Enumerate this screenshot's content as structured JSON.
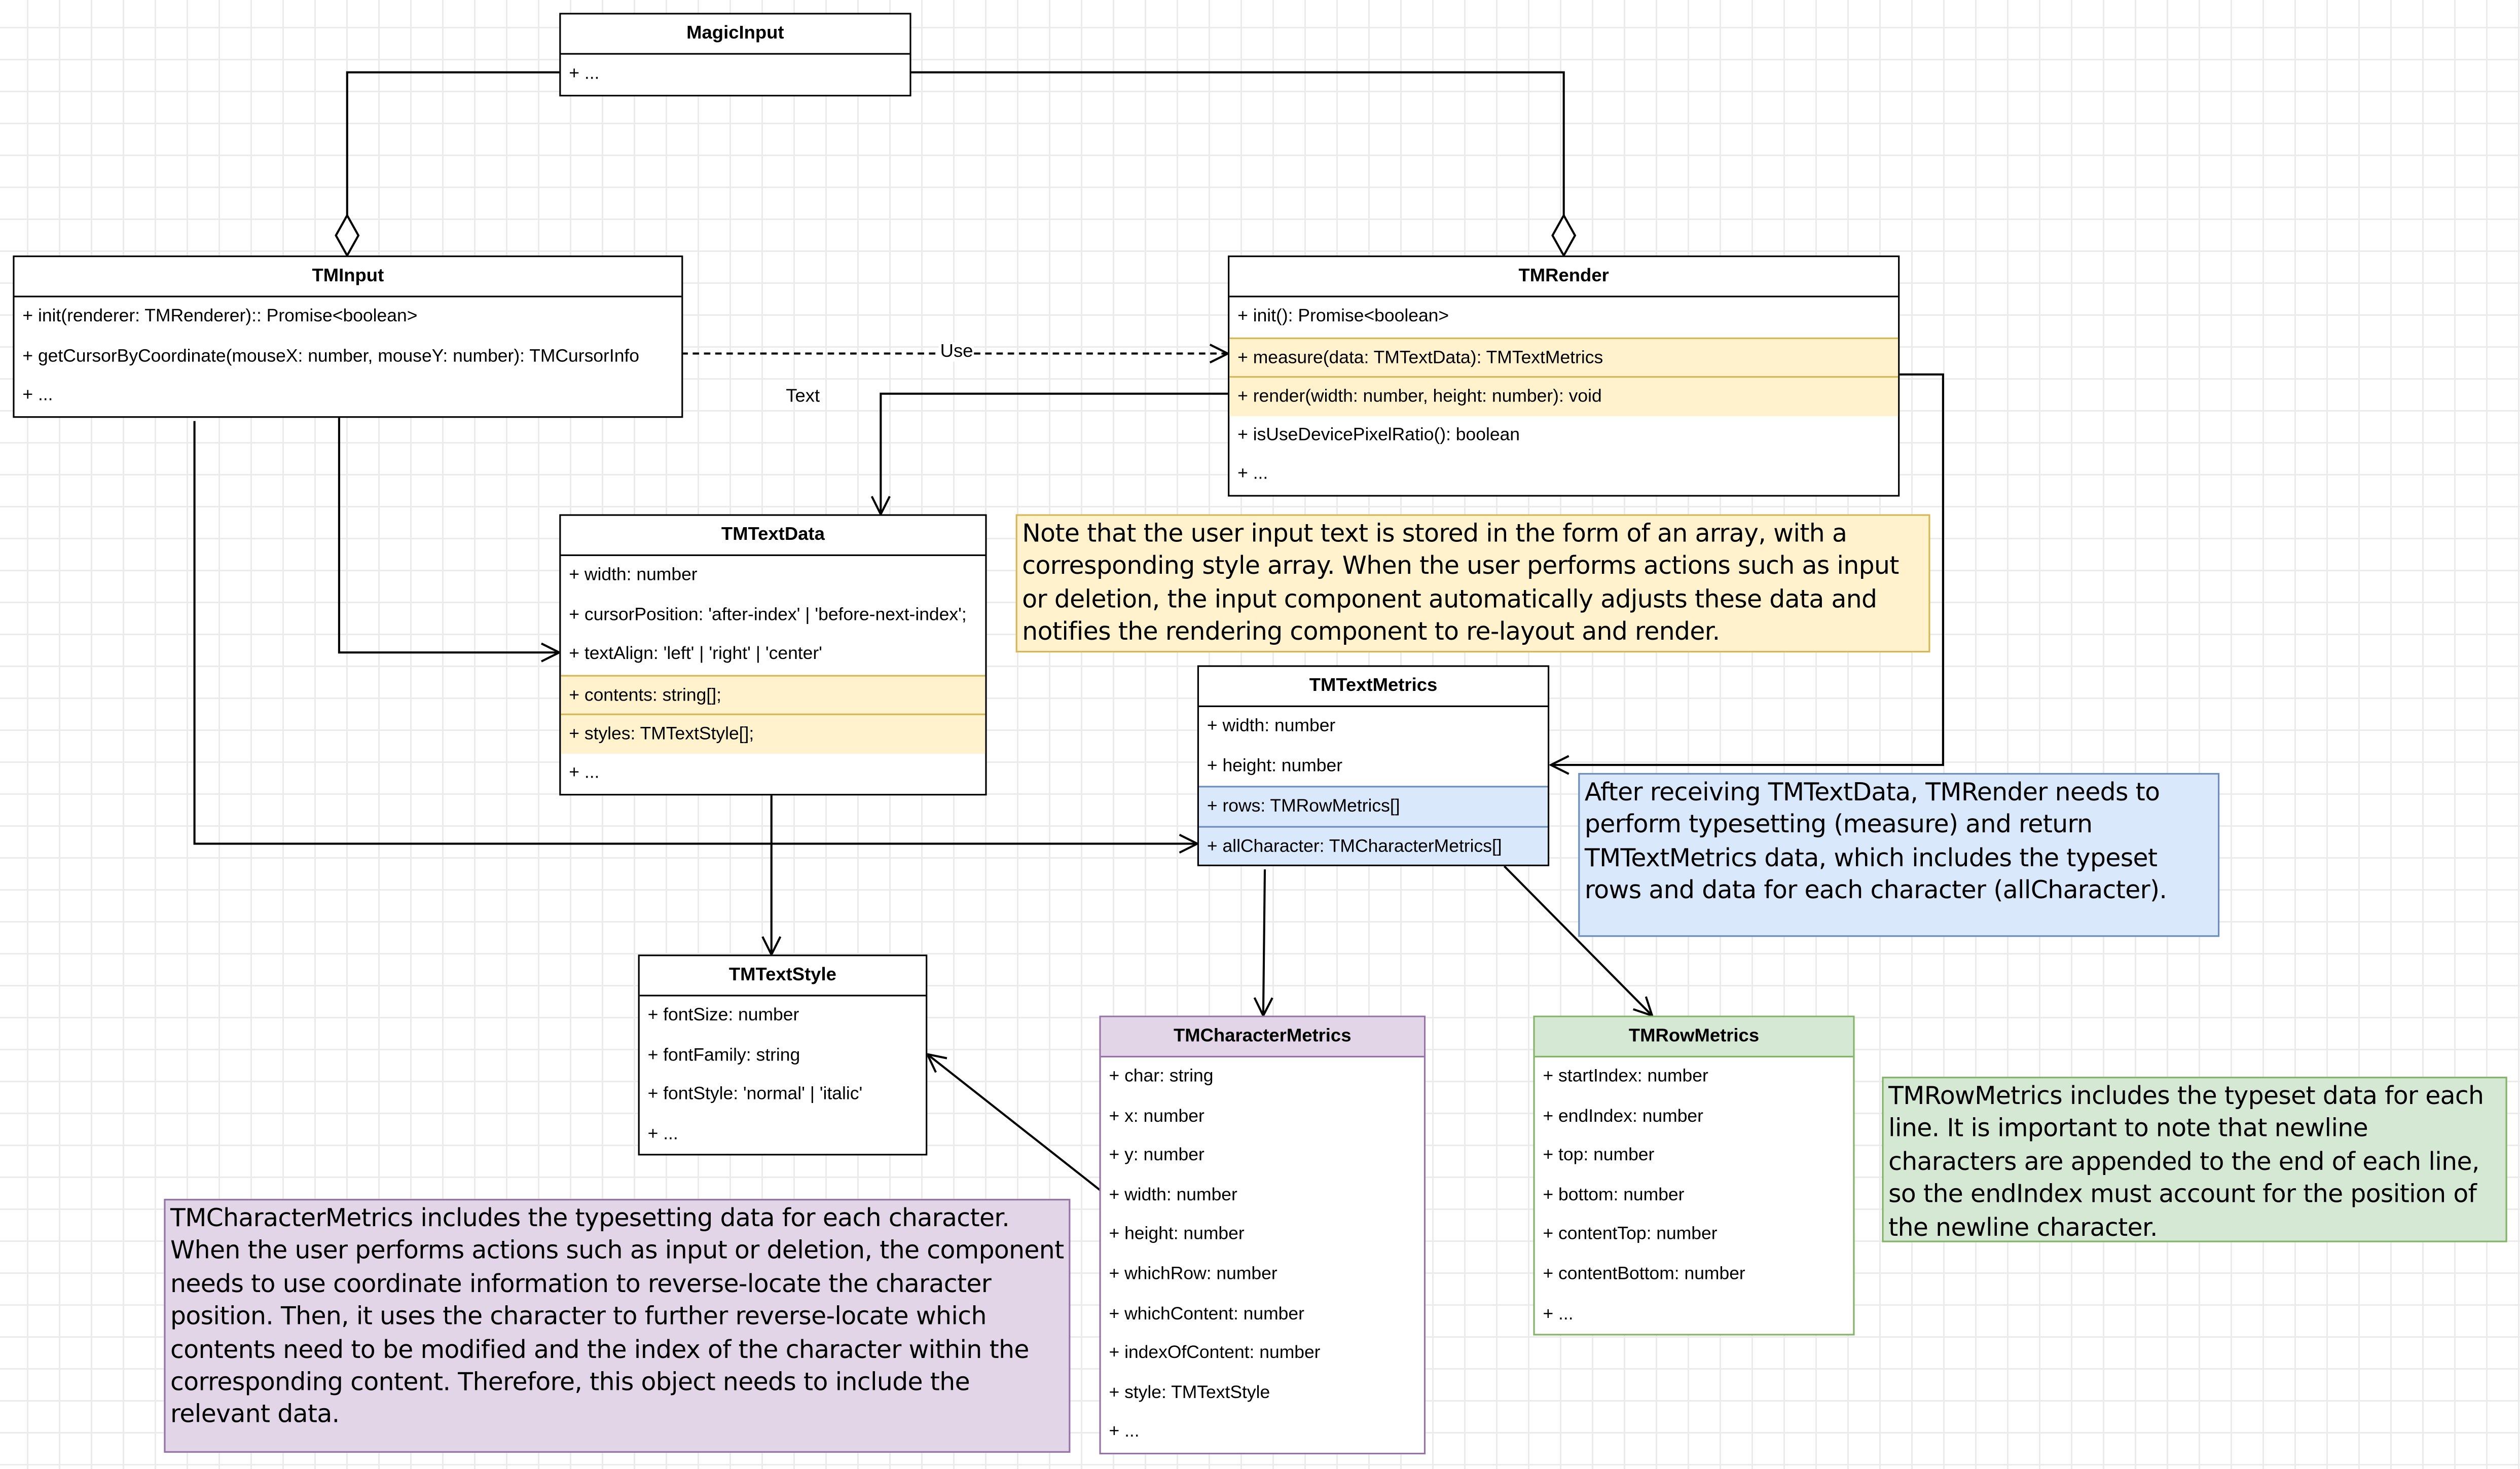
{
  "classes": {
    "magic_input": {
      "title": "MagicInput",
      "rows": [
        "+ ..."
      ]
    },
    "tm_input": {
      "title": "TMInput",
      "rows": [
        "+ init(renderer: TMRenderer):: Promise<boolean>",
        "+ getCursorByCoordinate(mouseX: number, mouseY: number): TMCursorInfo",
        "+ ..."
      ]
    },
    "tm_render": {
      "title": "TMRender",
      "rows": [
        "+ init(): Promise<boolean>",
        "+ measure(data: TMTextData): TMTextMetrics",
        "+ render(width: number, height: number): void",
        "+ isUseDevicePixelRatio(): boolean",
        "+ ..."
      ]
    },
    "tm_text_data": {
      "title": "TMTextData",
      "rows": [
        "+ width: number",
        "+ cursorPosition: 'after-index' | 'before-next-index';",
        "+ textAlign: 'left' | 'right' | 'center'",
        "+ contents: string[];",
        "+ styles: TMTextStyle[];",
        "+ ..."
      ]
    },
    "tm_text_metrics": {
      "title": "TMTextMetrics",
      "rows": [
        "+ width: number",
        "+ height: number",
        "+ rows: TMRowMetrics[]",
        "+ allCharacter: TMCharacterMetrics[]"
      ]
    },
    "tm_text_style": {
      "title": "TMTextStyle",
      "rows": [
        "+ fontSize: number",
        "+ fontFamily: string",
        "+ fontStyle: 'normal' | 'italic'",
        "+ ..."
      ]
    },
    "tm_character_metrics": {
      "title": "TMCharacterMetrics",
      "rows": [
        "+ char: string",
        "+ x: number",
        "+ y: number",
        "+ width: number",
        "+ height: number",
        "+ whichRow: number",
        "+ whichContent: number",
        "+ indexOfContent: number",
        "+ style: TMTextStyle",
        "+ ..."
      ]
    },
    "tm_row_metrics": {
      "title": "TMRowMetrics",
      "rows": [
        "+ startIndex: number",
        "+ endIndex: number",
        "+ top: number",
        "+ bottom: number",
        "+ contentTop: number",
        "+ contentBottom: number",
        "+ ..."
      ]
    }
  },
  "edge_labels": {
    "use": "Use",
    "text": "Text"
  },
  "notes": {
    "yellow": "Note that the user input text is stored in the form of an array, with a corresponding style array. When the user performs actions such as input or deletion, the input component automatically adjusts these data and notifies the rendering component to re-layout and render.",
    "blue": "After receiving TMTextData, TMRender needs to perform typesetting (measure) and return TMTextMetrics data, which includes the typeset rows and data for each character (allCharacter).",
    "green": "TMRowMetrics includes the typeset data for each line. It is important to note that newline characters are appended to the end of each line, so the endIndex must account for the position of the newline character.",
    "purple": "TMCharacterMetrics includes the typesetting data for each character. When the user performs actions such as input or deletion, the component needs to use coordinate information to reverse-locate the character position. Then, it uses the character to further reverse-locate which contents need to be modified and the index of the character within the corresponding content. Therefore, this object needs to include the relevant data."
  }
}
